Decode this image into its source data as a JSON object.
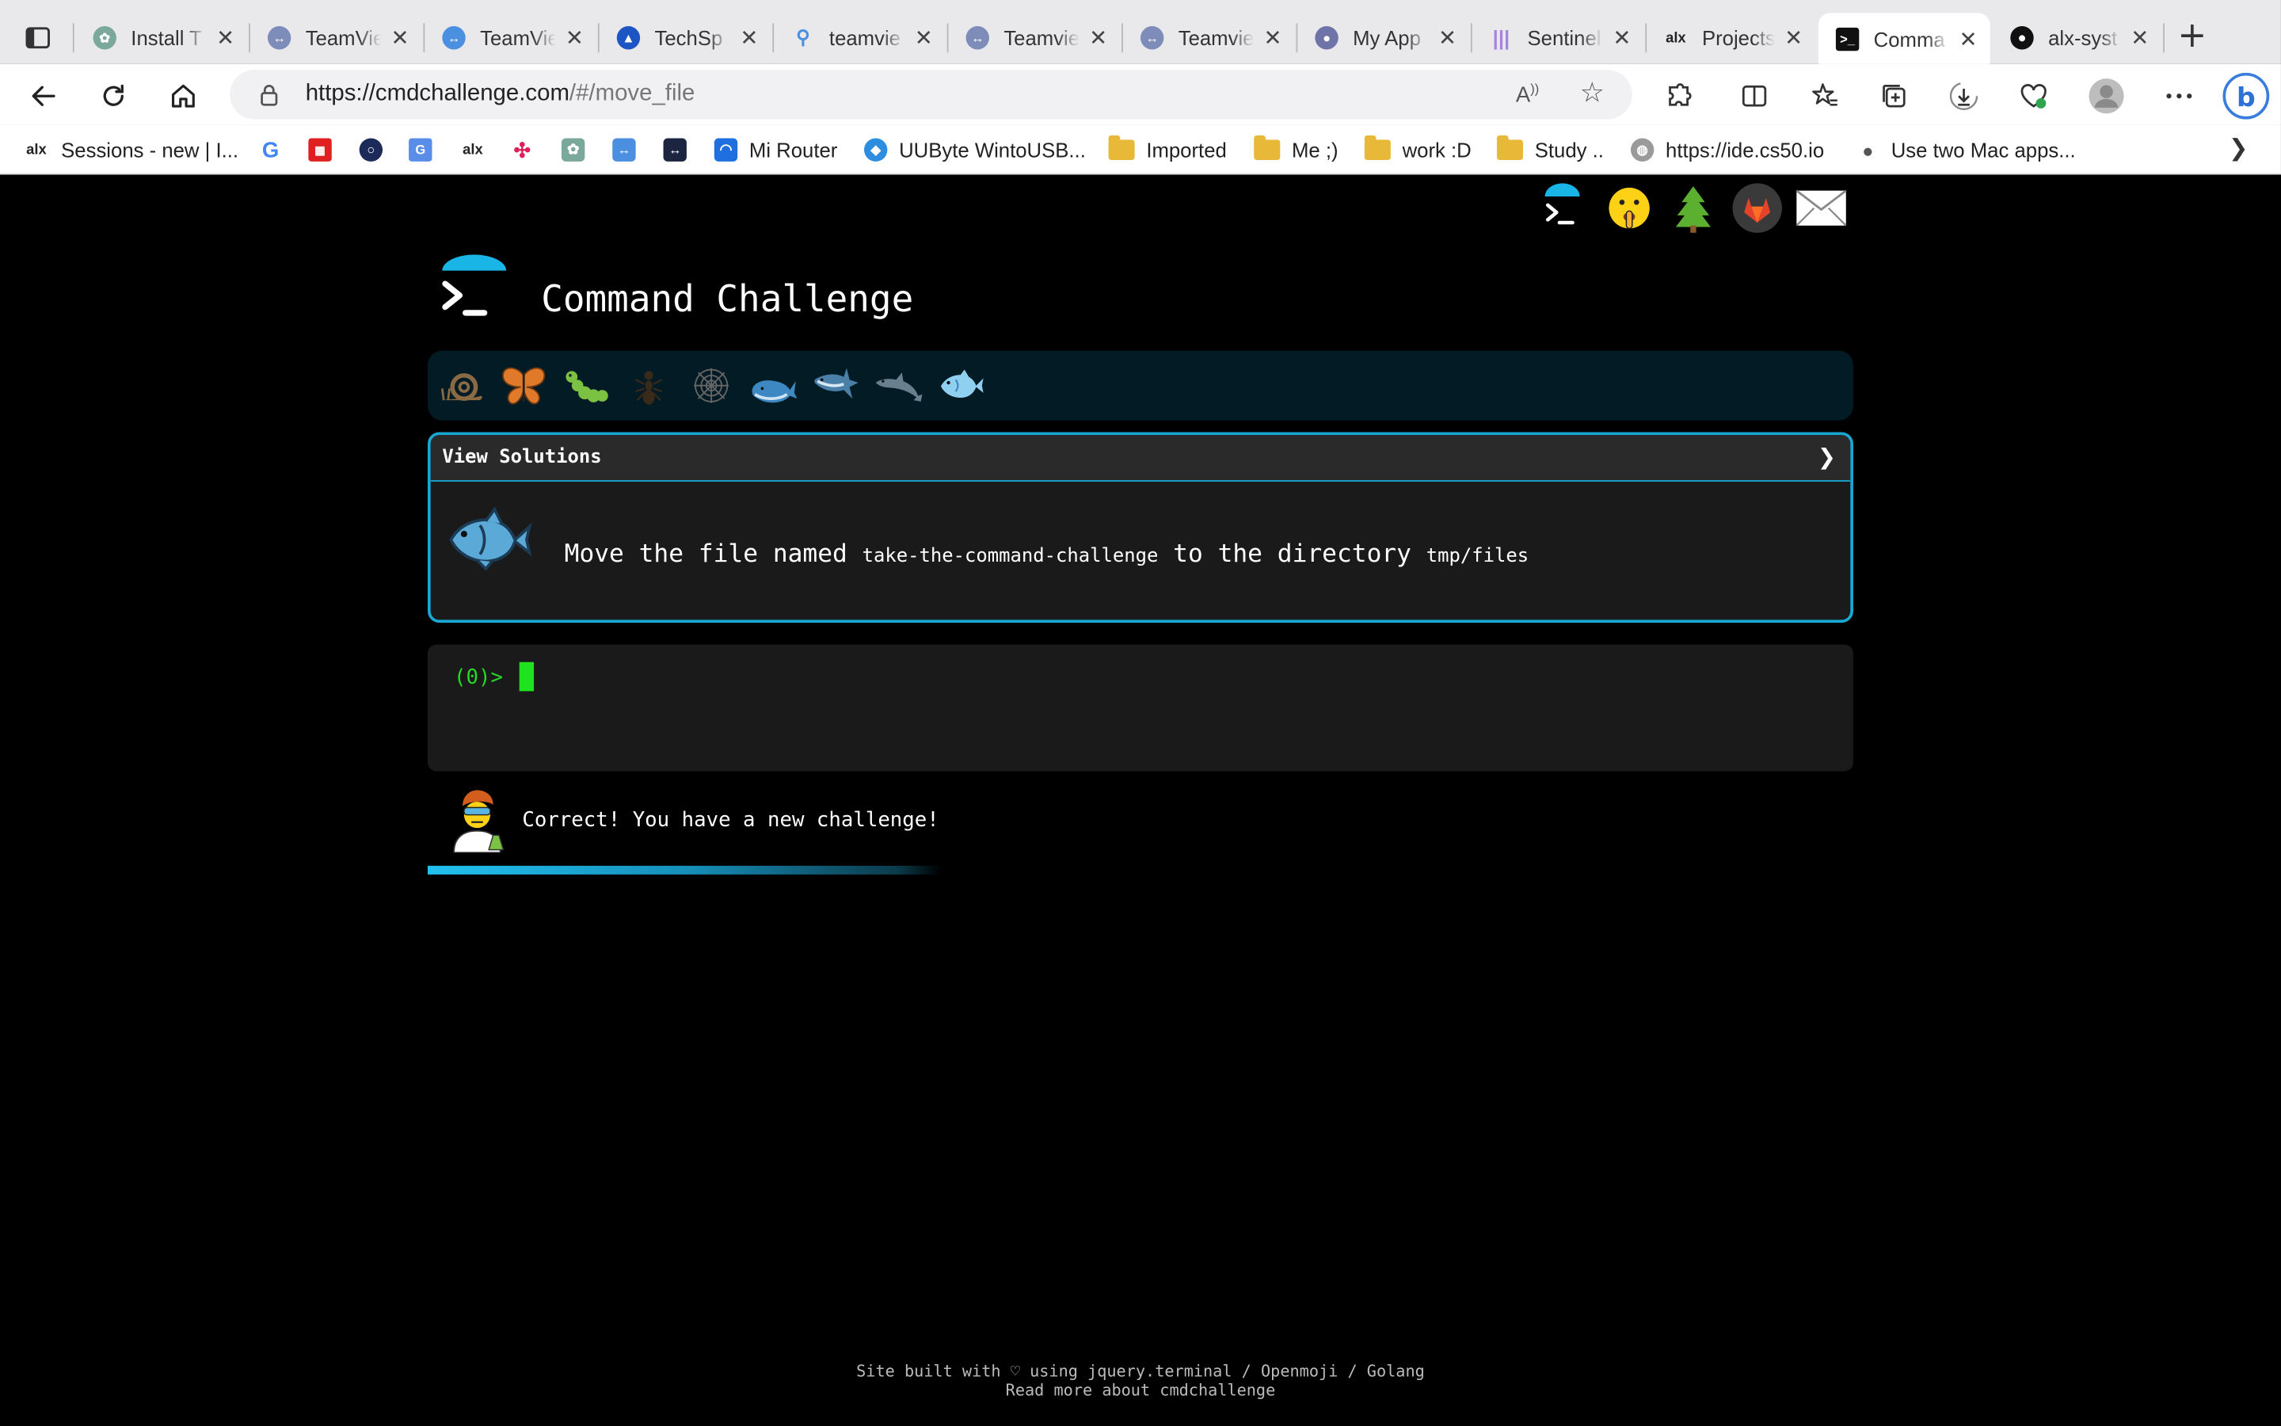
{
  "browser": {
    "tabs": [
      {
        "label": "Install T",
        "icon": "openai-icon",
        "color": "#7aa89a"
      },
      {
        "label": "TeamVie",
        "icon": "teamviewer-icon",
        "color": "#7d8cb8"
      },
      {
        "label": "TeamVie",
        "icon": "teamviewer-icon",
        "color": "#4a8fe0"
      },
      {
        "label": "TechSp",
        "icon": "techspot-icon",
        "color": "#1e55c4"
      },
      {
        "label": "teamvie",
        "icon": "search-icon",
        "color": "#4a8fe0"
      },
      {
        "label": "Teamvie",
        "icon": "teamviewer-icon",
        "color": "#7d8cb8"
      },
      {
        "label": "Teamvie",
        "icon": "teamviewer-icon",
        "color": "#7d8cb8"
      },
      {
        "label": "My App",
        "icon": "app-icon",
        "color": "#6e73a8"
      },
      {
        "label": "Sentinel",
        "icon": "sentinel-icon",
        "color": "#a884e0"
      },
      {
        "label": "Projects",
        "icon": "alx-icon",
        "color": "#222222"
      },
      {
        "label": "Comma",
        "icon": "cmdchallenge-icon",
        "color": "#111111"
      },
      {
        "label": "alx-syst",
        "icon": "github-icon",
        "color": "#111111"
      }
    ],
    "url_host": "https://cmdchallenge.com",
    "url_path": "/#/move_file",
    "bookmarks": [
      {
        "label": "Sessions - new | I...",
        "icon": "alx"
      },
      {
        "label": "Mi Router",
        "icon": "wifi"
      },
      {
        "label": "UUByte WintoUSB...",
        "icon": "uubyte"
      },
      {
        "label": "Imported",
        "icon": "folder"
      },
      {
        "label": "Me ;)",
        "icon": "folder"
      },
      {
        "label": "work :D",
        "icon": "folder"
      },
      {
        "label": "Study ..",
        "icon": "folder"
      },
      {
        "label": "https://ide.cs50.io",
        "icon": "globe"
      },
      {
        "label": "Use two Mac apps...",
        "icon": "apple"
      }
    ]
  },
  "page": {
    "title": "Command Challenge",
    "view_solutions": "View Solutions",
    "challenge": {
      "pre": "Move the file named ",
      "file": "take-the-command-challenge",
      "mid": " to the directory ",
      "dir": "tmp/files"
    },
    "prompt": "(0)> ",
    "result": "Correct! You have a new challenge!",
    "progress": 0.6,
    "footer_line1": "Site built with ♡ using jquery.terminal / Openmoji / Golang",
    "footer_line2": "Read more about cmdchallenge"
  },
  "colors": {
    "accent": "#19a8d2",
    "prompt": "#27d827"
  }
}
